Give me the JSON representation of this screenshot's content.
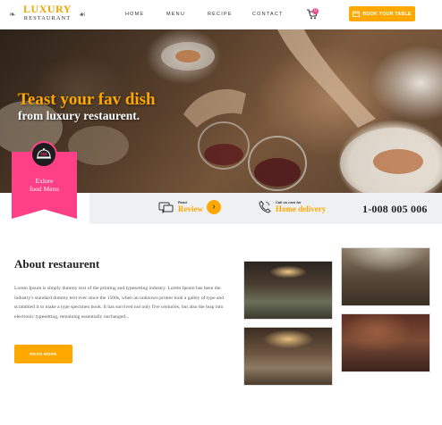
{
  "brand": {
    "line1": "LUXURY",
    "line2": "RESTAURANT"
  },
  "nav": {
    "home": "HOME",
    "menu": "MENU",
    "recipe": "RECIPE",
    "contact": "CONTACT"
  },
  "cart": {
    "icon": "cart-icon",
    "count": "0"
  },
  "book_button": {
    "label": "BOOK YOUR TABLE",
    "icon": "calendar-icon"
  },
  "hero": {
    "title": "Teast your fav dish",
    "subtitle": "from luxury restaurent."
  },
  "explore": {
    "label_line1": "Exlore",
    "label_line2": "food Menu",
    "icon": "dish-icon"
  },
  "info": {
    "review_label": "Read",
    "review_value": "Review",
    "delivery_label": "Call us now for",
    "delivery_value": "Home delivery",
    "phone": "1-008 005 006"
  },
  "about": {
    "title": "About restaurent",
    "text": "Lorem Ipsum is simply dummy text of the printing and typesetting industry. Lorem Ipsum has been the industry's standard dummy text ever since the 1500s, when an unknown printer took a galley of type and scrambled it to make a type specimen book. It has survived not only five centuries, but also the leap into electronic typesetting, remaining essentially unchanged...",
    "button": "READ MORE"
  },
  "colors": {
    "accent": "#ffa800",
    "pink": "#ff3f86",
    "dark": "#222222",
    "bar": "#eef0f2"
  }
}
